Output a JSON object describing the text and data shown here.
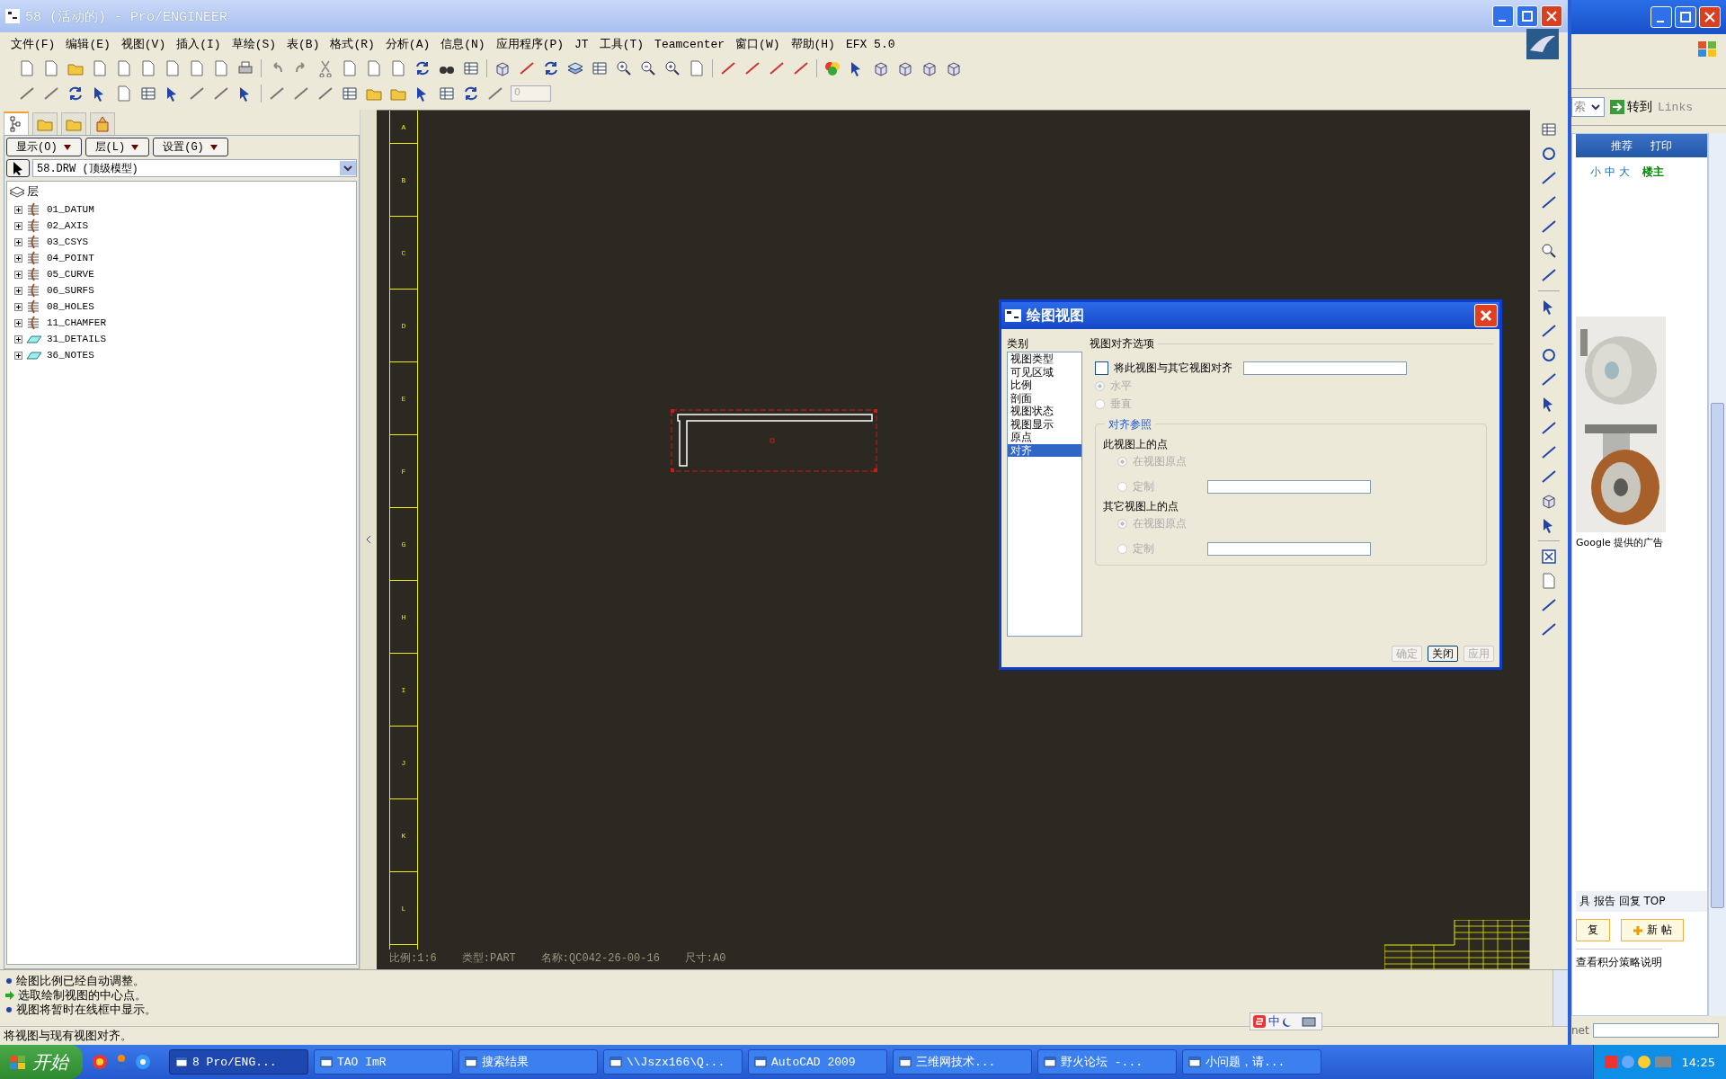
{
  "window": {
    "title": "58 (活动的) - Pro/ENGINEER"
  },
  "menu": [
    "文件(F)",
    "编辑(E)",
    "视图(V)",
    "插入(I)",
    "草绘(S)",
    "表(B)",
    "格式(R)",
    "分析(A)",
    "信息(N)",
    "应用程序(P)",
    "JT",
    "工具(T)",
    "Teamcenter",
    "窗口(W)",
    "帮助(H)",
    "EFX 5.0"
  ],
  "toolbar_field": {
    "value": "0"
  },
  "left_panel": {
    "tabs": [
      {
        "selected": true
      },
      {
        "selected": false
      },
      {
        "selected": false
      },
      {
        "selected": false
      }
    ],
    "buttons": [
      "显示(O)",
      "层(L)",
      "设置(G)"
    ],
    "model": "58.DRW (顶级模型)",
    "tree": {
      "label": "层",
      "children": [
        {
          "label": "01_DATUM",
          "kind": "layer",
          "expanded": false
        },
        {
          "label": "02_AXIS",
          "kind": "layer",
          "expanded": false
        },
        {
          "label": "03_CSYS",
          "kind": "layer",
          "expanded": false
        },
        {
          "label": "04_POINT",
          "kind": "layer",
          "expanded": false
        },
        {
          "label": "05_CURVE",
          "kind": "layer",
          "expanded": false
        },
        {
          "label": "06_SURFS",
          "kind": "layer",
          "expanded": false
        },
        {
          "label": "08_HOLES",
          "kind": "layer",
          "expanded": false
        },
        {
          "label": "11_CHAMFER",
          "kind": "layer",
          "expanded": false
        },
        {
          "label": "31_DETAILS",
          "kind": "flat",
          "expanded": false
        },
        {
          "label": "36_NOTES",
          "kind": "flat",
          "expanded": false
        }
      ]
    }
  },
  "drawing": {
    "border_labels": [
      "A",
      "B",
      "C",
      "D",
      "E",
      "F",
      "G",
      "H",
      "I",
      "J",
      "K",
      "L"
    ],
    "info": [
      "比例:1:6",
      "类型:PART",
      "名称:QC042-26-00-16",
      "尺寸:A0"
    ]
  },
  "dialog": {
    "title": "绘图视图",
    "category_label": "类别",
    "categories": [
      {
        "label": "视图类型",
        "selected": false
      },
      {
        "label": "可见区域",
        "selected": false
      },
      {
        "label": "比例",
        "selected": false
      },
      {
        "label": "剖面",
        "selected": false
      },
      {
        "label": "视图状态",
        "selected": false
      },
      {
        "label": "视图显示",
        "selected": false
      },
      {
        "label": "原点",
        "selected": false
      },
      {
        "label": "对齐",
        "selected": true
      }
    ],
    "section": "视图对齐选项",
    "align": {
      "label": "将此视图与其它视图对齐",
      "checked": false
    },
    "orientation": [
      {
        "label": "水平",
        "selected": true,
        "disabled": true
      },
      {
        "label": "垂直",
        "selected": false,
        "disabled": true
      }
    ],
    "group": "对齐参照",
    "points": [
      {
        "label": "此视图上的点",
        "options": [
          {
            "label": "在视图原点",
            "selected": true,
            "disabled": true
          },
          {
            "label": "定制",
            "selected": false,
            "disabled": true
          }
        ]
      },
      {
        "label": "其它视图上的点",
        "options": [
          {
            "label": "在视图原点",
            "selected": true,
            "disabled": true
          },
          {
            "label": "定制",
            "selected": false,
            "disabled": true
          }
        ]
      }
    ],
    "buttons": [
      {
        "label": "确定",
        "disabled": true
      },
      {
        "label": "关闭",
        "disabled": false
      },
      {
        "label": "应用",
        "disabled": true
      }
    ]
  },
  "messages": [
    {
      "kind": "info",
      "text": "绘图比例已经自动调整。"
    },
    {
      "kind": "prompt",
      "text": "选取绘制视图的中心点。"
    },
    {
      "kind": "info",
      "text": "视图将暂时在线框中显示。"
    }
  ],
  "status": "将视图与现有视图对齐。",
  "browser": {
    "search": "索",
    "go": "转到",
    "links": "Links",
    "actions": [
      "推荐",
      "打印"
    ],
    "sizes": [
      "小",
      "中",
      "大"
    ],
    "owner": "楼主",
    "ad_label": "Google 提供的广告",
    "post_links": "具 报告 回复 TOP",
    "buttons": [
      "复",
      "新 帖"
    ],
    "points_link": "查看积分策略说明",
    "footer": "net"
  },
  "ime": {
    "label": "中"
  },
  "taskbar": {
    "start": "开始",
    "tasks": [
      {
        "label": "8 Pro/ENG...",
        "selected": true
      },
      {
        "label": "TAO ImR",
        "selected": false
      },
      {
        "label": "搜索结果",
        "selected": false
      },
      {
        "label": "\\\\Jszx166\\Q...",
        "selected": false
      },
      {
        "label": "AutoCAD 2009",
        "selected": false
      },
      {
        "label": "三维网技术...",
        "selected": false
      },
      {
        "label": "野火论坛 -...",
        "selected": false
      },
      {
        "label": "小问题，请...",
        "selected": false
      }
    ],
    "clock": "14:25"
  }
}
